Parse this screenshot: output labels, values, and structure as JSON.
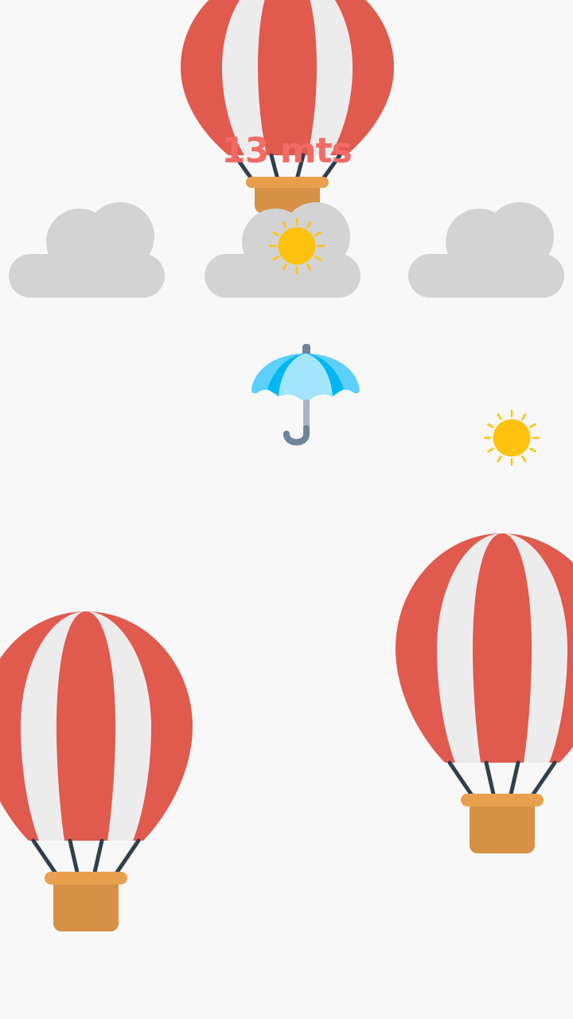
{
  "hud": {
    "distance_value": "13",
    "distance_unit": "mts"
  },
  "sprites": {
    "balloon": "hot-air-balloon-icon",
    "cloud": "cloud-icon",
    "sun": "sun-icon",
    "player": "umbrella-icon"
  },
  "colors": {
    "background": "#f8f8f8",
    "balloon_red": "#e05a4e",
    "balloon_white": "#ececec",
    "basket": "#d69146",
    "basket_rim": "#e8a04e",
    "ropes": "#2f3f4e",
    "cloud": "#d3d3d3",
    "sun": "#ffc20e",
    "umbrella_light": "#a3e6fc",
    "umbrella_mid": "#5cd0fb",
    "umbrella_dark": "#00b7f4",
    "umbrella_handle": "#6f8499",
    "score_text": "#f46b66"
  }
}
